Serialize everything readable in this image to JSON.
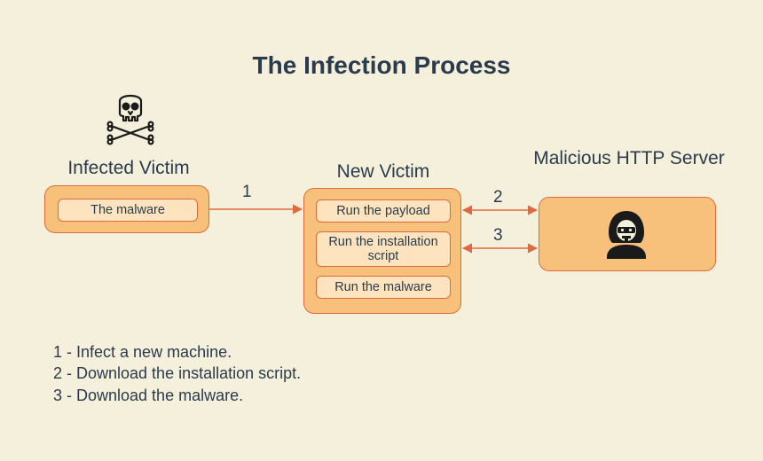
{
  "diagram": {
    "title": "The Infection Process",
    "nodes": {
      "infected": {
        "label": "Infected Victim",
        "steps": [
          "The malware"
        ]
      },
      "new_victim": {
        "label": "New Victim",
        "steps": [
          "Run the payload",
          "Run the installation script",
          "Run the malware"
        ]
      },
      "server": {
        "label": "Malicious HTTP Server"
      }
    },
    "arrows": {
      "a1": "1",
      "a2": "2",
      "a3": "3"
    },
    "legend": {
      "l1": "1 - Infect a new machine.",
      "l2": "2 - Download the installation script.",
      "l3": "3 - Download the malware."
    }
  }
}
